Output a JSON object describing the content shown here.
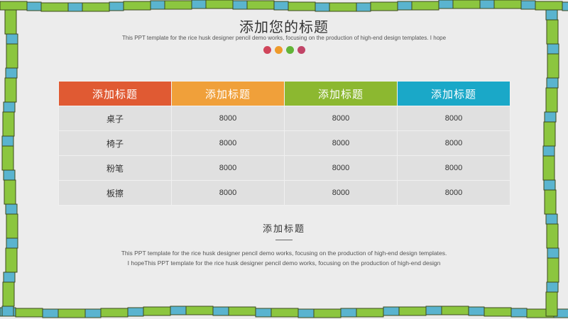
{
  "slide": {
    "title": "添加您的标题",
    "subtitle": "This PPT template for the rice husk designer pencil demo works, focusing on the production of high-end design templates. I hope",
    "dot_colors": [
      "#d0455a",
      "#ee9a2b",
      "#62b437",
      "#c14467"
    ]
  },
  "table": {
    "headers": [
      {
        "label": "添加标题",
        "color": "#e05a33"
      },
      {
        "label": "添加标题",
        "color": "#f0a03a"
      },
      {
        "label": "添加标题",
        "color": "#8cb830"
      },
      {
        "label": "添加标题",
        "color": "#1aa8c8"
      }
    ],
    "rows": [
      {
        "name": "桌子",
        "values": [
          "8000",
          "8000",
          "8000"
        ]
      },
      {
        "name": "椅子",
        "values": [
          "8000",
          "8000",
          "8000"
        ]
      },
      {
        "name": "粉笔",
        "values": [
          "8000",
          "8000",
          "8000"
        ]
      },
      {
        "name": "板擦",
        "values": [
          "8000",
          "8000",
          "8000"
        ]
      }
    ]
  },
  "section": {
    "title": "添加标题",
    "lines": [
      "This PPT template for the rice husk designer pencil demo works, focusing on the production of high-end design templates.",
      "I hopeThis PPT template for the rice husk designer pencil demo works, focusing on the production of high-end design"
    ]
  },
  "frame": {
    "green": "#8cc63f",
    "blue": "#5ab4cf",
    "outline": "#3c4a1e"
  }
}
